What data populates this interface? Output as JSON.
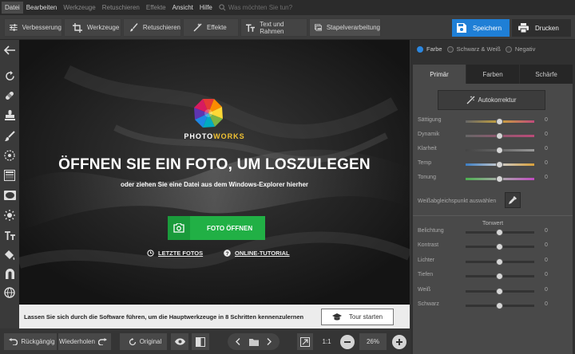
{
  "menu": {
    "items": [
      "Datei",
      "Bearbeiten",
      "Werkzeuge",
      "Retuschieren",
      "Effekte",
      "Ansicht",
      "Hilfe"
    ],
    "search_placeholder": "Was möchten Sie tun?"
  },
  "toolbar": {
    "tabs": [
      "Verbesserung",
      "Werkzeuge",
      "Retuschieren",
      "Effekte",
      "Text und Rahmen",
      "Stapelverarbeitung"
    ],
    "save_label": "Speichern",
    "print_label": "Drucken",
    "accent": "#1f7fd6"
  },
  "sidebar": {
    "icons": [
      "arrow-left-icon",
      "rotate-icon",
      "healing-icon",
      "stamp-icon",
      "brush-icon",
      "radial-icon",
      "gradient-icon",
      "vignette-icon",
      "light-icon",
      "text-icon",
      "bucket-icon",
      "magnet-icon",
      "sphere-icon"
    ]
  },
  "canvas": {
    "brand_a": "PHOTO",
    "brand_b": "WORKS",
    "title": "ÖFFNEN SIE EIN FOTO, UM LOSZULEGEN",
    "subtitle": "oder ziehen Sie eine Datei aus dem Windows-Explorer hierher",
    "open_label": "FOTO ÖFFNEN",
    "recent_label": "LETZTE FOTOS",
    "tutorial_label": "ONLINE-TUTORIAL",
    "open_color": "#21b045"
  },
  "tour": {
    "text": "Lassen Sie sich durch die Software führen, um die Hauptwerkzeuge in 8 Schritten kennenzulernen",
    "button_label": "Tour starten"
  },
  "bottom": {
    "undo_label": "Rückgängig",
    "redo_label": "Wiederholen",
    "original_label": "Original",
    "ratio_label": "1:1",
    "zoom": "26%"
  },
  "panel": {
    "modes": [
      "Farbe",
      "Schwarz & Weiß",
      "Negativ"
    ],
    "tabs": [
      "Primär",
      "Farben",
      "Schärfe"
    ],
    "auto_label": "Autokorrektur",
    "sliders": [
      {
        "label": "Sättigung",
        "value": "0",
        "level": 0.5
      },
      {
        "label": "Dynamik",
        "value": "0",
        "level": 0.5
      },
      {
        "label": "Klarheit",
        "value": "0",
        "level": 0.5
      },
      {
        "label": "Temp",
        "value": "0",
        "level": 0.5
      },
      {
        "label": "Tonung",
        "value": "0",
        "level": 0.5
      }
    ],
    "wb_label": "Weißabgleichspunkt auswählen",
    "tone_header": "Tonwert",
    "tone_sliders": [
      {
        "label": "Belichtung",
        "value": "0",
        "level": 0.5
      },
      {
        "label": "Kontrast",
        "value": "0",
        "level": 0.5
      },
      {
        "label": "Lichter",
        "value": "0",
        "level": 0.5
      },
      {
        "label": "Tiefen",
        "value": "0",
        "level": 0.5
      },
      {
        "label": "Weiß",
        "value": "0",
        "level": 0.5
      },
      {
        "label": "Schwarz",
        "value": "0",
        "level": 0.5
      }
    ]
  }
}
